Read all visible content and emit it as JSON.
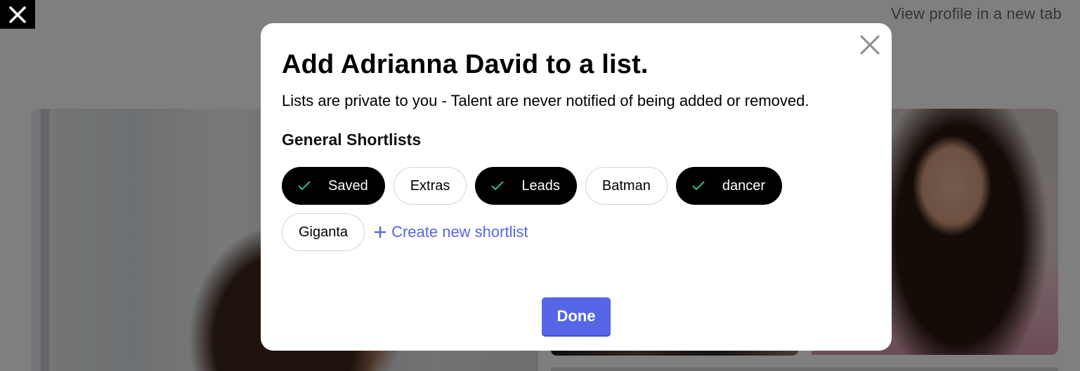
{
  "background": {
    "view_profile_link": "View profile in a new tab"
  },
  "top_close": {
    "icon": "close-icon"
  },
  "modal": {
    "title": "Add Adrianna David to a list.",
    "description": "Lists are private to you - Talent are never notified of being added or removed.",
    "section_title": "General Shortlists",
    "shortlists": [
      {
        "label": "Saved",
        "selected": true
      },
      {
        "label": "Extras",
        "selected": false
      },
      {
        "label": "Leads",
        "selected": true
      },
      {
        "label": "Batman",
        "selected": false
      },
      {
        "label": "dancer",
        "selected": true
      },
      {
        "label": "Giganta",
        "selected": false
      }
    ],
    "create_label": "Create new shortlist",
    "done_label": "Done",
    "close_icon": "close-icon"
  },
  "colors": {
    "accent": "#5567e6",
    "selected_chip": "#000000",
    "check": "#2ec27e",
    "overlay": "rgba(0,0,0,0.5)"
  }
}
